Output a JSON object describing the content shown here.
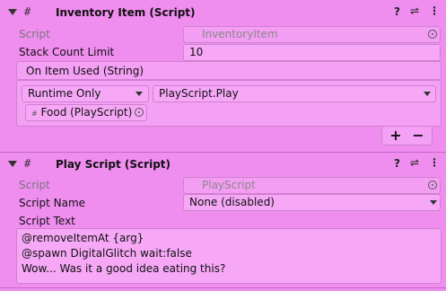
{
  "inventory_item": {
    "title": "Inventory Item (Script)",
    "script_label": "Script",
    "script_value": "InventoryItem",
    "stack_label": "Stack Count Limit",
    "stack_value": "10",
    "event_header": "On Item Used (String)",
    "runtime_option": "Runtime Only",
    "function_value": "PlayScript.Play",
    "object_value": "Food (PlayScript)",
    "add_button": "+",
    "remove_button": "−"
  },
  "play_script": {
    "title": "Play Script (Script)",
    "script_label": "Script",
    "script_value": "PlayScript",
    "script_name_label": "Script Name",
    "script_name_value": "None (disabled)",
    "script_text_label": "Script Text",
    "script_text_lines": [
      "@removeItemAt {arg}",
      "@spawn DigitalGlitch wait:false",
      "Wow... Was it a good idea eating this?"
    ]
  },
  "icons": {
    "header_icons": [
      "help-icon",
      "presets-icon",
      "menu-icon"
    ]
  },
  "colors": {
    "background": "#f08ef0",
    "field": "#f6a8f6",
    "border": "#d080d0"
  }
}
